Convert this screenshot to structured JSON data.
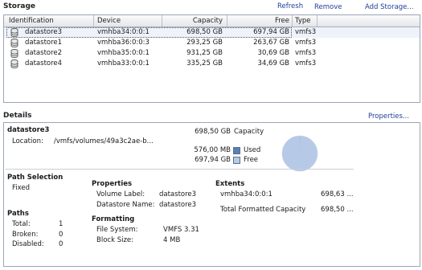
{
  "storage": {
    "title": "Storage",
    "actions": {
      "refresh": "Refresh",
      "remove": "Remove",
      "add": "Add Storage..."
    },
    "columns": {
      "identification": "Identification",
      "device": "Device",
      "capacity": "Capacity",
      "free": "Free",
      "type": "Type"
    },
    "rows": [
      {
        "name": "datastore3",
        "device": "vmhba34:0:0:1",
        "capacity": "698,50 GB",
        "free": "697,94 GB",
        "type": "vmfs3",
        "selected": true
      },
      {
        "name": "datastore1",
        "device": "vmhba36:0:0:3",
        "capacity": "293,25 GB",
        "free": "263,67 GB",
        "type": "vmfs3",
        "selected": false
      },
      {
        "name": "datastore2",
        "device": "vmhba35:0:0:1",
        "capacity": "931,25 GB",
        "free": "30,69 GB",
        "type": "vmfs3",
        "selected": false
      },
      {
        "name": "datastore4",
        "device": "vmhba33:0:0:1",
        "capacity": "335,25 GB",
        "free": "34,69 GB",
        "type": "vmfs3",
        "selected": false
      }
    ]
  },
  "details": {
    "title": "Details",
    "properties_link": "Properties...",
    "datastore_name": "datastore3",
    "location_label": "Location:",
    "location_value": "/vmfs/volumes/49a3c2ae-b...",
    "capacity_value": "698,50 GB",
    "capacity_label": "Capacity",
    "used_value": "576,00 MB",
    "used_label": "Used",
    "free_value": "697,94 GB",
    "free_label": "Free",
    "used_fraction": 0.0008,
    "colors": {
      "used": "#5b7fb3",
      "free": "#b6c9e6"
    },
    "path_selection": {
      "title": "Path Selection",
      "value": "Fixed"
    },
    "paths": {
      "title": "Paths",
      "total_label": "Total:",
      "total_value": "1",
      "broken_label": "Broken:",
      "broken_value": "0",
      "disabled_label": "Disabled:",
      "disabled_value": "0"
    },
    "properties": {
      "title": "Properties",
      "volume_label_label": "Volume Label:",
      "volume_label_value": "datastore3",
      "datastore_name_label": "Datastore Name:",
      "datastore_name_value": "datastore3"
    },
    "formatting": {
      "title": "Formatting",
      "fs_label": "File System:",
      "fs_value": "VMFS 3.31",
      "block_label": "Block Size:",
      "block_value": "4 MB"
    },
    "extents": {
      "title": "Extents",
      "device": "vmhba34:0:0:1",
      "device_size": "698,63 ...",
      "total_label": "Total Formatted Capacity",
      "total_value": "698,50 ..."
    }
  }
}
